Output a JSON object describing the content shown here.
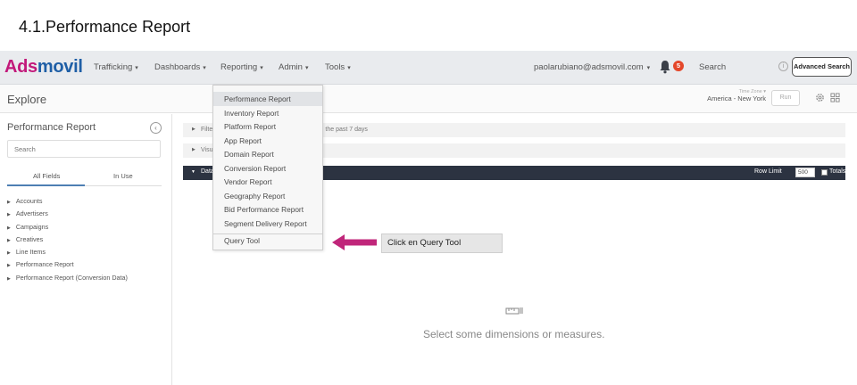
{
  "slide": {
    "title": "4.1.Performance Report"
  },
  "navbar": {
    "logo_part1": "Ads",
    "logo_part2": "movil",
    "menus": [
      "Trafficking",
      "Dashboards",
      "Reporting",
      "Admin",
      "Tools"
    ],
    "user_email": "paolarubiano@adsmovil.com",
    "notification_count": "5",
    "search_label": "Search",
    "advanced_search": "Advanced Search"
  },
  "explore": {
    "title": "Explore",
    "time_zone_label": "Time Zone",
    "time_zone_value": "America - New York",
    "run_label": "Run"
  },
  "left_panel": {
    "title": "Performance Report",
    "search_placeholder": "Search",
    "tabs": [
      "All Fields",
      "In Use"
    ],
    "fields": [
      "Accounts",
      "Advertisers",
      "Campaigns",
      "Creatives",
      "Line Items",
      "Performance Report",
      "Performance Report (Conversion Data)"
    ]
  },
  "main": {
    "filter_prefix": "Filte",
    "filter_suffix": "in the past 7 days",
    "visualization_label": "Visu",
    "data_label": "Data",
    "row_limit_label": "Row Limit",
    "row_limit_value": "500",
    "totals_label": "Totals",
    "empty_message": "Select some dimensions or measures."
  },
  "dropdown": {
    "items": [
      "Performance Report",
      "Inventory Report",
      "Platform Report",
      "App Report",
      "Domain Report",
      "Conversion Report",
      "Vendor Report",
      "Geography Report",
      "Bid Performance Report",
      "Segment Delivery Report",
      "Query Tool"
    ]
  },
  "annotation": {
    "text": "Click en Query Tool",
    "arrow_color": "#c0267a"
  },
  "colors": {
    "brand_pink": "#c2187a",
    "brand_blue": "#1f5fa6",
    "data_bar": "#2c3341",
    "badge": "#e4472a"
  }
}
